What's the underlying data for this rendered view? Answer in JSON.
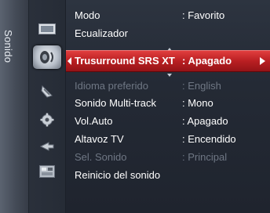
{
  "sidebar": {
    "caption": "Sonido"
  },
  "icons": [
    {
      "name": "picture-icon",
      "glyph": "▬"
    },
    {
      "name": "sound-icon",
      "glyph": "◉"
    },
    {
      "name": "channel-icon",
      "glyph": "◥"
    },
    {
      "name": "setup-icon",
      "glyph": "⚙"
    },
    {
      "name": "input-icon",
      "glyph": "≼"
    },
    {
      "name": "application-icon",
      "glyph": "▦"
    }
  ],
  "menu": {
    "rows": [
      {
        "label": "Modo",
        "value": ": Favorito"
      },
      {
        "label": "Ecualizador",
        "value": ""
      },
      {
        "label": "Trusurround SRS XT",
        "value": ": Apagado"
      },
      {
        "label": "Idioma preferido",
        "value": ": English"
      },
      {
        "label": "Sonido Multi-track",
        "value": ": Mono"
      },
      {
        "label": "Vol.Auto",
        "value": ": Apagado"
      },
      {
        "label": "Altavoz TV",
        "value": ": Encendido"
      },
      {
        "label": "Sel. Sonido",
        "value": ": Principal"
      },
      {
        "label": "Reinicio del sonido",
        "value": ""
      }
    ]
  },
  "colors": {
    "highlight": "#c62828",
    "text": "#ffffff",
    "disabled_text": "#6f7784"
  }
}
